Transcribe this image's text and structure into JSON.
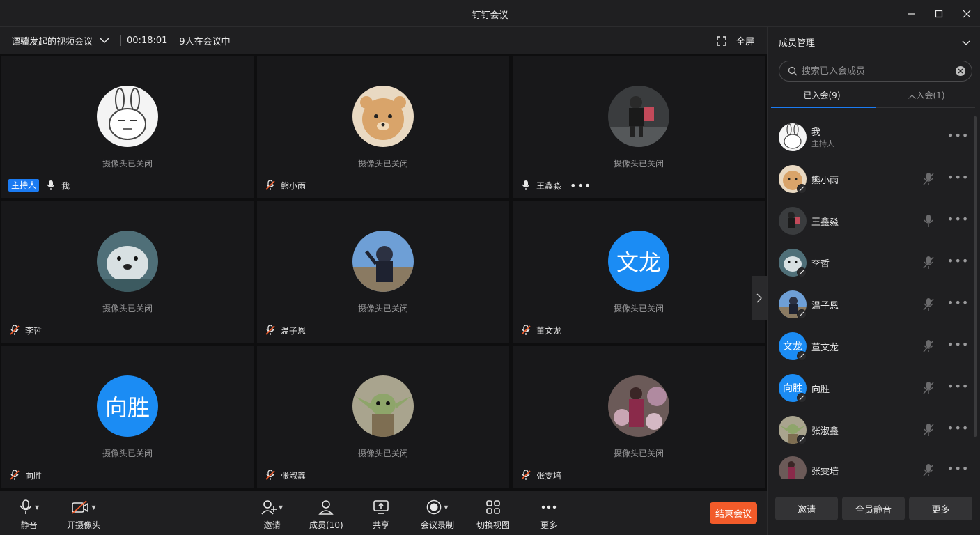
{
  "window": {
    "title": "钉钉会议"
  },
  "infobar": {
    "meeting_title": "谭骥发起的视频会议",
    "duration": "00:18:01",
    "participants_status": "9人在会议中",
    "fullscreen_label": "全屏"
  },
  "tiles": [
    {
      "name": "我",
      "camera_status": "摄像头已关闭",
      "host_badge": "主持人",
      "mic": "on",
      "avatar": "rabbit"
    },
    {
      "name": "熊小雨",
      "camera_status": "摄像头已关闭",
      "mic": "muted",
      "avatar": "bear"
    },
    {
      "name": "王鑫淼",
      "camera_status": "摄像头已关闭",
      "mic": "on",
      "avatar": "photo-dark",
      "more": "•••"
    },
    {
      "name": "李哲",
      "camera_status": "摄像头已关闭",
      "mic": "muted",
      "avatar": "otter"
    },
    {
      "name": "温子恩",
      "camera_status": "摄像头已关闭",
      "mic": "muted",
      "avatar": "photo-sky"
    },
    {
      "name": "董文龙",
      "camera_status": "摄像头已关闭",
      "mic": "muted",
      "avatar_text": "文龙"
    },
    {
      "name": "向胜",
      "camera_status": "摄像头已关闭",
      "mic": "muted",
      "avatar_text": "向胜"
    },
    {
      "name": "张淑鑫",
      "camera_status": "摄像头已关闭",
      "mic": "muted",
      "avatar": "yoda"
    },
    {
      "name": "张雯培",
      "camera_status": "摄像头已关闭",
      "mic": "muted",
      "avatar": "photo-flowers"
    }
  ],
  "toolbar": {
    "mute_label": "静音",
    "camera_label": "开摄像头",
    "invite_label": "邀请",
    "members_label": "成员(10)",
    "share_label": "共享",
    "record_label": "会议录制",
    "switch_view_label": "切换视图",
    "more_label": "更多",
    "end_label": "结束会议"
  },
  "panel": {
    "title": "成员管理",
    "search_placeholder": "搜索已入会成员",
    "tab_joined": "已入会(9)",
    "tab_not_joined": "未入会(1)",
    "members": [
      {
        "name": "我",
        "role": "主持人",
        "avatar": "rabbit",
        "more": "•••"
      },
      {
        "name": "熊小雨",
        "avatar": "bear",
        "mic": "muted",
        "more": "•••"
      },
      {
        "name": "王鑫淼",
        "avatar": "photo-dark",
        "mic": "on",
        "more": "•••"
      },
      {
        "name": "李哲",
        "avatar": "otter",
        "mic": "muted",
        "more": "•••"
      },
      {
        "name": "温子恩",
        "avatar": "photo-sky",
        "mic": "muted",
        "more": "•••"
      },
      {
        "name": "董文龙",
        "avatar_text": "文龙",
        "mic": "muted",
        "more": "•••"
      },
      {
        "name": "向胜",
        "avatar_text": "向胜",
        "mic": "muted",
        "more": "•••"
      },
      {
        "name": "张淑鑫",
        "avatar": "yoda",
        "mic": "muted",
        "more": "•••"
      },
      {
        "name": "张雯培",
        "avatar": "photo-flowers",
        "mic": "muted",
        "more": "•••"
      }
    ],
    "invite_button": "邀请",
    "mute_all_button": "全员静音",
    "more_button": "更多"
  },
  "colors": {
    "accent": "#1b7bf2",
    "end_button": "#f25b2a",
    "muted_red": "#f25b2a",
    "background": "#1f1f21",
    "tile_bg": "#18181a"
  }
}
